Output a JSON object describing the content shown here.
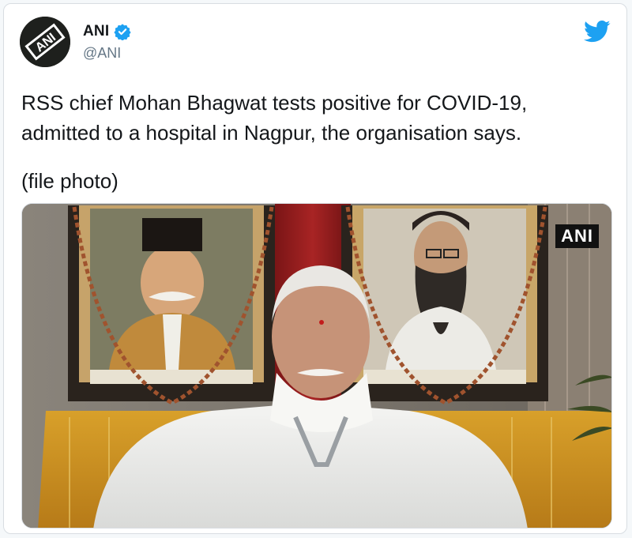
{
  "author": {
    "display_name": "ANI",
    "handle": "@ANI",
    "verified": true,
    "avatar_text": "ANI"
  },
  "icons": {
    "verified": "verified-badge-icon",
    "bird": "twitter-bird-icon"
  },
  "tweet": {
    "text": "RSS chief Mohan Bhagwat tests positive for COVID-19, admitted to a hospital in Nagpur, the organisation says.",
    "note": "(file photo)"
  },
  "media": {
    "watermark": "ANI"
  },
  "colors": {
    "twitter_blue": "#1da1f2",
    "text": "#14171a",
    "secondary": "#657786"
  }
}
